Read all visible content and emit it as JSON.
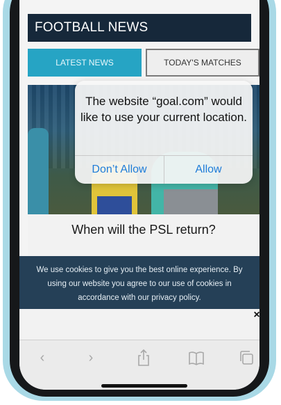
{
  "header": {
    "title": "FOOTBALL NEWS"
  },
  "tabs": [
    {
      "label": "LATEST NEWS"
    },
    {
      "label": "TODAY'S MATCHES"
    }
  ],
  "article": {
    "headline": "When will the PSL return?"
  },
  "location_alert": {
    "message": "The website “goal.com” would like to use your current location.",
    "dont_allow": "Don’t Allow",
    "allow": "Allow"
  },
  "cookie_banner": {
    "text": "We use cookies to give you the best online experience. By using our website you agree to our use of cookies in accordance with our privacy policy.",
    "close": "×"
  },
  "toolbar": {
    "back_icon": "‹",
    "forward_icon": "›",
    "share_icon": "share-icon",
    "bookmarks_icon": "book-icon",
    "tabs_icon": "tabs-icon"
  },
  "colors": {
    "header_bg": "#16283a",
    "tab_active": "#26a4c4",
    "alert_button": "#1e7cd8",
    "cookie_bg": "#1c3850",
    "phone_case": "#a9d9e6"
  }
}
